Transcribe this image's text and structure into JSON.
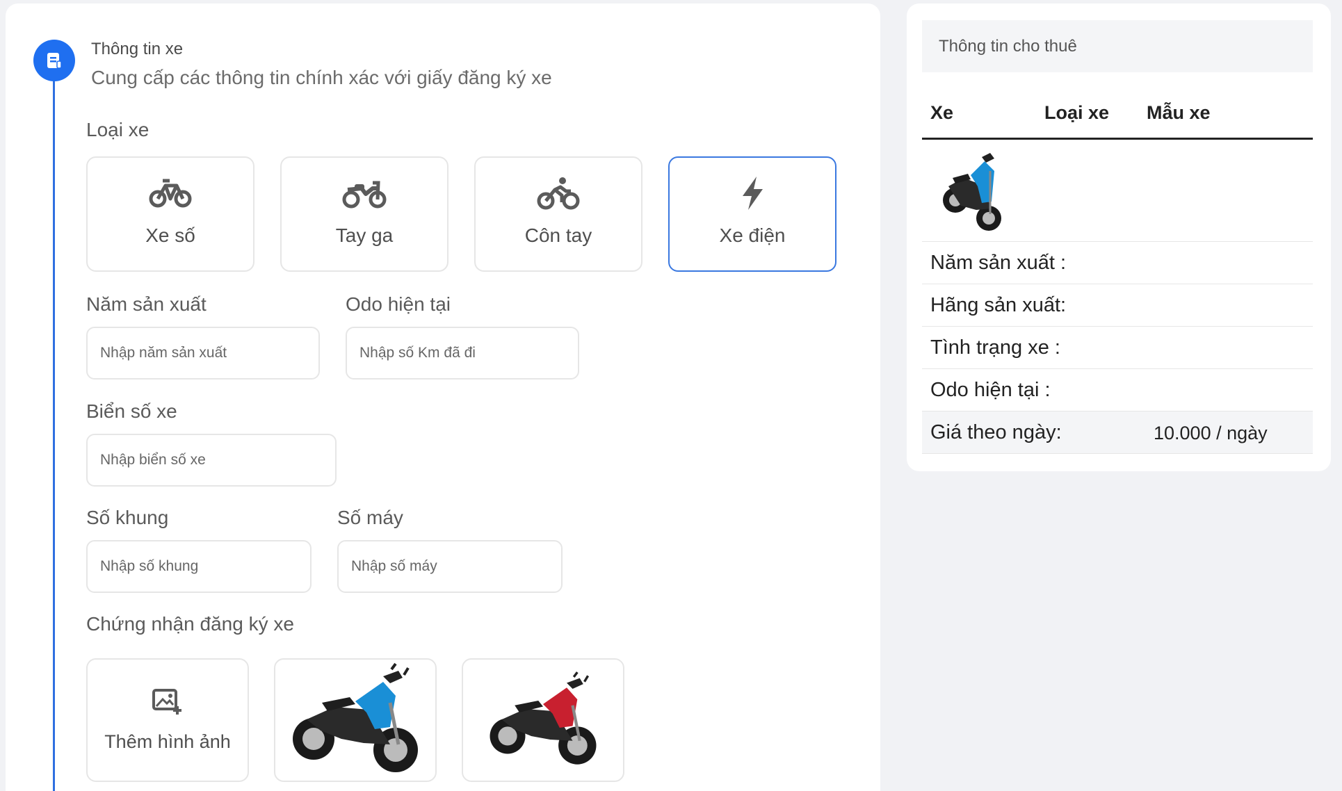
{
  "step": {
    "icon": "document-icon",
    "title": "Thông tin xe",
    "subtitle": "Cung cấp các thông tin chính xác với giấy đăng ký xe"
  },
  "vehicle_type": {
    "label": "Loại xe",
    "options": [
      {
        "label": "Xe số",
        "icon": "bicycle-icon",
        "selected": false
      },
      {
        "label": "Tay ga",
        "icon": "motorcycle-icon",
        "selected": false
      },
      {
        "label": "Côn tay",
        "icon": "cyclist-icon",
        "selected": false
      },
      {
        "label": "Xe điện",
        "icon": "lightning-icon",
        "selected": true
      }
    ]
  },
  "fields": {
    "year": {
      "label": "Năm sản xuất",
      "placeholder": "Nhập năm sản xuất",
      "value": ""
    },
    "odo": {
      "label": "Odo hiện tại",
      "placeholder": "Nhập số Km đã đi",
      "value": ""
    },
    "plate": {
      "label": "Biển số xe",
      "placeholder": "Nhập biển số xe",
      "value": ""
    },
    "frame": {
      "label": "Số khung",
      "placeholder": "Nhập số khung",
      "value": ""
    },
    "engine": {
      "label": "Số máy",
      "placeholder": "Nhập số máy",
      "value": ""
    }
  },
  "registration": {
    "label": "Chứng nhận đăng ký xe",
    "add_label": "Thêm hình ảnh",
    "add_icon": "add-image-icon",
    "images": [
      {
        "name": "motorbike-blue",
        "color": "#1a8fd6"
      },
      {
        "name": "motorbike-red",
        "color": "#c8202f"
      }
    ]
  },
  "rental_info": {
    "title": "Thông tin cho thuê",
    "columns": [
      "Xe",
      "Loại xe",
      "Mẫu xe"
    ],
    "bike_color": "#1a8fd6",
    "rows": [
      {
        "label": "Năm sản xuất :",
        "value": ""
      },
      {
        "label": "Hãng sản xuất:",
        "value": ""
      },
      {
        "label": "Tình trạng xe :",
        "value": ""
      },
      {
        "label": "Odo hiện tại :",
        "value": ""
      },
      {
        "label": "Giá theo ngày:",
        "value": "10.000 / ngày"
      }
    ]
  },
  "colors": {
    "accent": "#1f6ff0",
    "selected_border": "#3a78e0",
    "background": "#f1f2f5"
  }
}
